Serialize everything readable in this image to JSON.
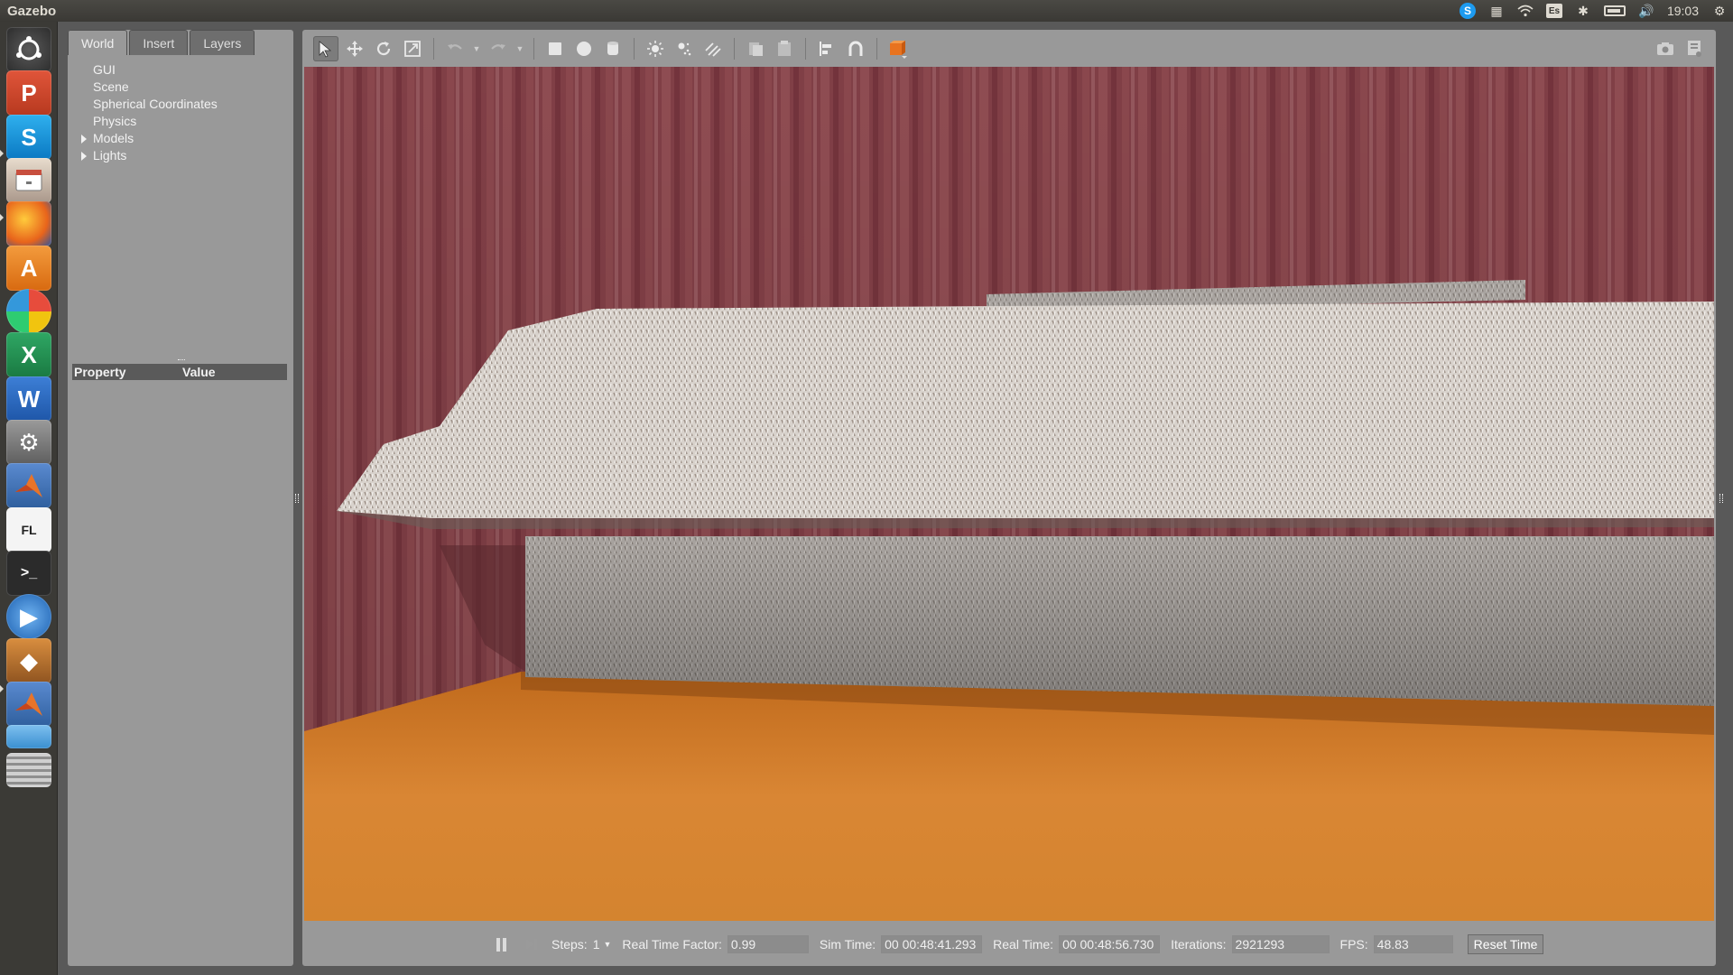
{
  "app": {
    "title": "Gazebo"
  },
  "system_tray": {
    "keyboard_layout": "Es",
    "clock": "19:03"
  },
  "launcher": {
    "items": [
      "ubuntu-dash-icon",
      "powerpoint-icon",
      "skype-icon",
      "files-icon",
      "firefox-icon",
      "software-center-icon",
      "photos-icon",
      "excel-icon",
      "word-icon",
      "system-settings-icon",
      "matlab-icon",
      "fl-studio-icon",
      "terminal-icon",
      "video-player-icon",
      "virtualbox-icon",
      "matlab-icon-2",
      "workspace-switcher-icon",
      "trash-icon"
    ]
  },
  "left_panel": {
    "tabs": [
      {
        "label": "World",
        "active": true
      },
      {
        "label": "Insert",
        "active": false
      },
      {
        "label": "Layers",
        "active": false
      }
    ],
    "tree": [
      {
        "label": "GUI",
        "expandable": false
      },
      {
        "label": "Scene",
        "expandable": false
      },
      {
        "label": "Spherical Coordinates",
        "expandable": false
      },
      {
        "label": "Physics",
        "expandable": false
      },
      {
        "label": "Models",
        "expandable": true
      },
      {
        "label": "Lights",
        "expandable": true
      }
    ],
    "properties": {
      "col_property": "Property",
      "col_value": "Value"
    }
  },
  "toolbar": {
    "tools": [
      "select-mode-icon",
      "translate-mode-icon",
      "rotate-mode-icon",
      "scale-mode-icon",
      "undo-icon",
      "redo-icon",
      "box-shape-icon",
      "sphere-shape-icon",
      "cylinder-shape-icon",
      "point-light-icon",
      "spot-light-icon",
      "directional-light-icon",
      "copy-icon",
      "paste-icon",
      "align-icon",
      "snap-icon",
      "view-angle-icon",
      "screenshot-icon",
      "log-icon"
    ]
  },
  "status_bar": {
    "steps_label": "Steps:",
    "steps_value": "1",
    "rtf_label": "Real Time Factor:",
    "rtf_value": "0.99",
    "sim_time_label": "Sim Time:",
    "sim_time_value": "00 00:48:41.293",
    "real_time_label": "Real Time:",
    "real_time_value": "00 00:48:56.730",
    "iterations_label": "Iterations:",
    "iterations_value": "2921293",
    "fps_label": "FPS:",
    "fps_value": "48.83",
    "reset_label": "Reset Time"
  },
  "colors": {
    "curtain": "#87424a",
    "floor": "#d6822e",
    "sofa": "#cfc8c0",
    "panel_bg": "#999999",
    "window_bg": "#595959"
  }
}
